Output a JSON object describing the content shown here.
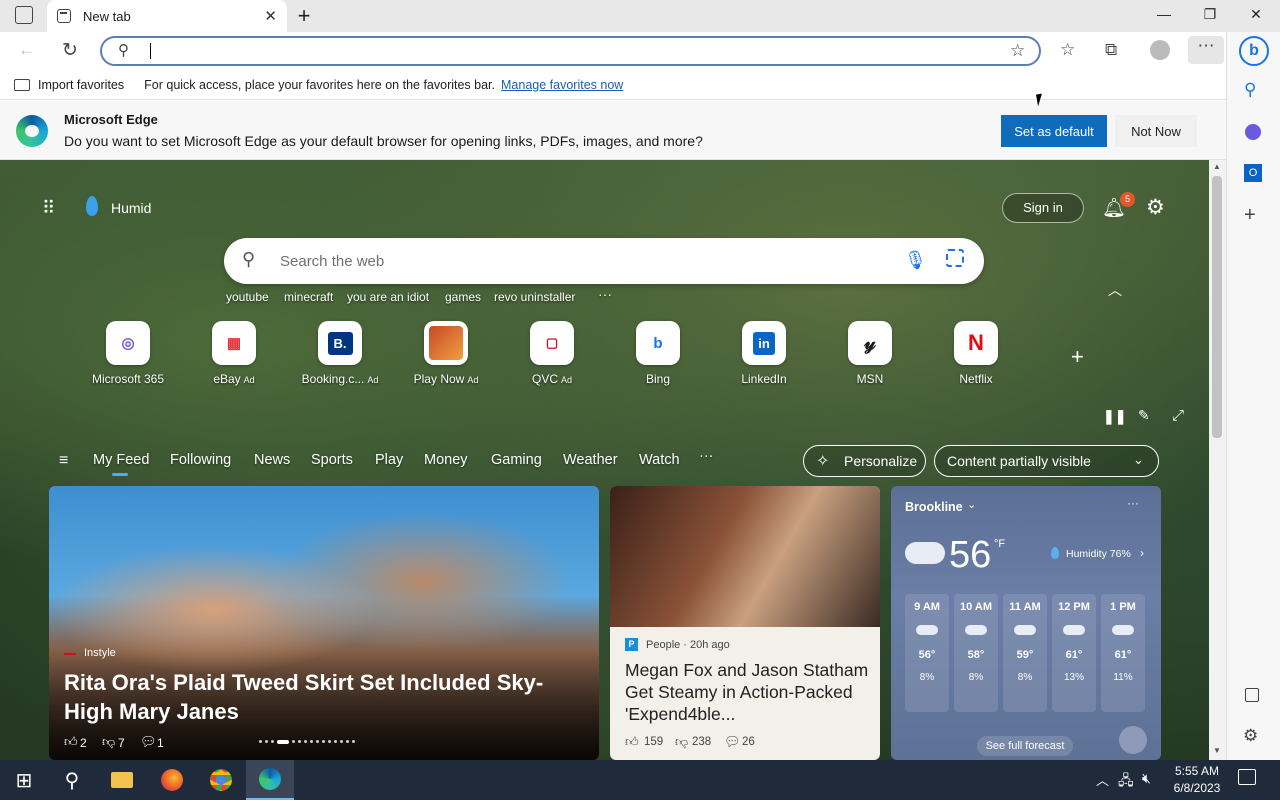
{
  "tab": {
    "title": "New tab"
  },
  "favbar": {
    "import": "Import favorites",
    "message": "For quick access, place your favorites here on the favorites bar.",
    "link": "Manage favorites now"
  },
  "infobar": {
    "title": "Microsoft Edge",
    "message": "Do you want to set Microsoft Edge as your default browser for opening links, PDFs, images, and more?",
    "set_default": "Set as default",
    "not_now": "Not Now"
  },
  "ntp": {
    "weather_label": "Humid",
    "signin": "Sign in",
    "notif_count": "5",
    "search_placeholder": "Search the web",
    "suggestions": [
      "youtube",
      "minecraft",
      "you are an idiot",
      "games",
      "revo uninstaller"
    ],
    "tiles": [
      {
        "label": "Microsoft 365",
        "ad": ""
      },
      {
        "label": "eBay",
        "ad": "Ad"
      },
      {
        "label": "Booking.c...",
        "ad": "Ad"
      },
      {
        "label": "Play Now",
        "ad": "Ad"
      },
      {
        "label": "QVC",
        "ad": "Ad"
      },
      {
        "label": "Bing",
        "ad": ""
      },
      {
        "label": "LinkedIn",
        "ad": ""
      },
      {
        "label": "MSN",
        "ad": ""
      },
      {
        "label": "Netflix",
        "ad": ""
      }
    ],
    "nav": [
      "My Feed",
      "Following",
      "News",
      "Sports",
      "Play",
      "Money",
      "Gaming",
      "Weather",
      "Watch"
    ],
    "personalize": "Personalize",
    "content_visibility": "Content partially visible"
  },
  "feed": {
    "card1": {
      "source": "Instyle",
      "headline": "Rita Ora's Plaid Tweed Skirt Set Included Sky-High Mary Janes",
      "likes": "2",
      "dislikes": "7",
      "comments": "1"
    },
    "card2": {
      "source": "People · 20h ago",
      "headline": "Megan Fox and Jason Statham Get Steamy in Action-Packed 'Expend4ble...",
      "likes": "159",
      "dislikes": "238",
      "comments": "26"
    }
  },
  "weather": {
    "location": "Brookline",
    "temp": "56",
    "unit": "°F",
    "humidity": "Humidity 76%",
    "hours": [
      {
        "time": "9 AM",
        "temp": "56°",
        "precip": "8%"
      },
      {
        "time": "10 AM",
        "temp": "58°",
        "precip": "8%"
      },
      {
        "time": "11 AM",
        "temp": "59°",
        "precip": "8%"
      },
      {
        "time": "12 PM",
        "temp": "61°",
        "precip": "13%"
      },
      {
        "time": "1 PM",
        "temp": "61°",
        "precip": "11%"
      }
    ],
    "forecast_link": "See full forecast"
  },
  "taskbar": {
    "time": "5:55 AM",
    "date": "6/8/2023"
  }
}
